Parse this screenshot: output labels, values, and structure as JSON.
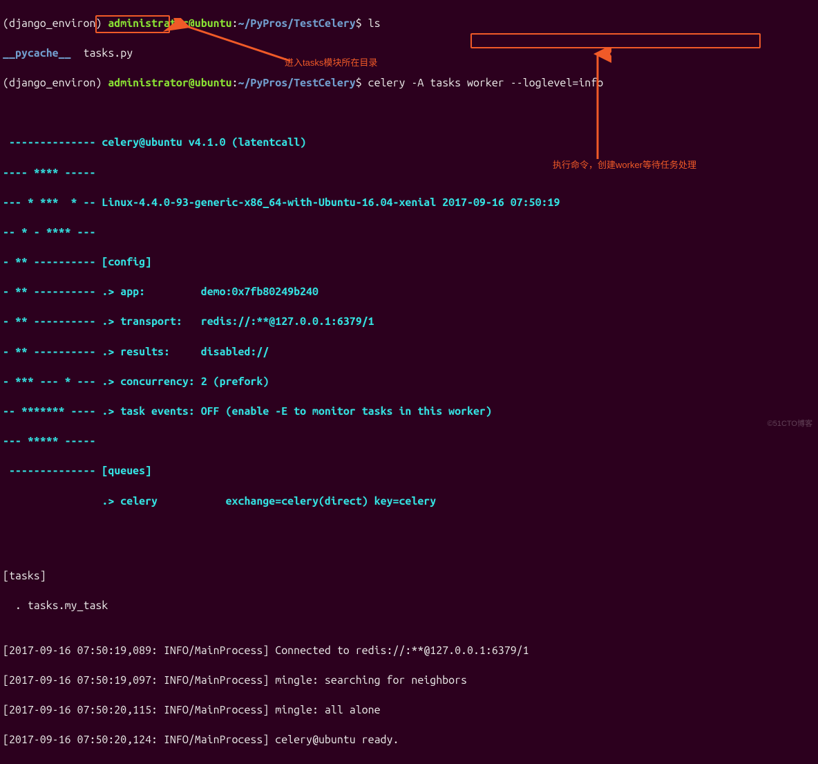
{
  "prompt1": {
    "env": "(django_environ) ",
    "userhost": "administrator@ubuntu",
    "colon": ":",
    "path": "~/PyPros/TestCelery",
    "dollar": "$ ",
    "cmd": "ls"
  },
  "ls_output": {
    "dir": "__pycache__",
    "file": "  tasks.py"
  },
  "prompt2": {
    "env": "(django_environ) ",
    "userhost": "administrator@ubuntu",
    "colon": ":",
    "path": "~/PyPros/TestCelery",
    "dollar": "$ ",
    "cmd": "celery -A tasks worker --loglevel=info"
  },
  "banner": {
    "l0": " ",
    "l1a": " -------------- ",
    "l1b": "celery@ubuntu v4.1.0 (latentcall)",
    "l2": "---- **** ----- ",
    "l3a": "--- * ***  * -- ",
    "l3b": "Linux-4.4.0-93-generic-x86_64-with-Ubuntu-16.04-xenial 2017-09-16 07:50:19",
    "l4": "-- * - **** --- ",
    "l5a": "- ** ---------- ",
    "l5b": "[config]",
    "l6a": "- ** ---------- ",
    "l6b": ".> app:         demo:0x7fb80249b240",
    "l7a": "- ** ---------- ",
    "l7b": ".> transport:   redis://:**@127.0.0.1:6379/1",
    "l8a": "- ** ---------- ",
    "l8b": ".> results:     disabled://",
    "l9a": "- *** --- * --- ",
    "l9b": ".> concurrency: 2 (prefork)",
    "l10a": "-- ******* ---- ",
    "l10b": ".> task events: OFF (enable -E to monitor tasks in this worker)",
    "l11": "--- ***** ----- ",
    "l12a": " -------------- ",
    "l12b": "[queues]",
    "l13a": "                ",
    "l13b": ".> celery           exchange=celery(direct) key=celery",
    "l14": "                ",
    "l15": ""
  },
  "tasks_header": "[tasks]",
  "tasks_item": "  . tasks.my_task",
  "blank": "",
  "logs": {
    "r0": "[2017-09-16 07:50:19,089: INFO/MainProcess] Connected to redis://:**@127.0.0.1:6379/1",
    "r1": "[2017-09-16 07:50:19,097: INFO/MainProcess] mingle: searching for neighbors",
    "r2": "[2017-09-16 07:50:20,115: INFO/MainProcess] mingle: all alone",
    "r3": "[2017-09-16 07:50:20,124: INFO/MainProcess] celery@ubuntu ready."
  },
  "annotations": {
    "left": "进入tasks模块所在目录",
    "right": "执行命令，创建worker等待任务处理"
  },
  "watermark": "©51CTO博客"
}
